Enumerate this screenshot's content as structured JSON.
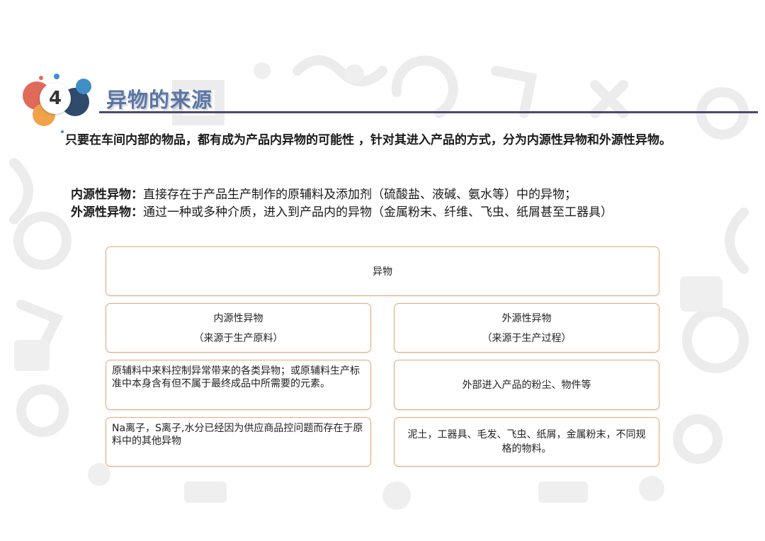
{
  "header": {
    "section_number": "4",
    "section_title": "异物的来源"
  },
  "intro": "只要在车间内部的物品，都有成为产品内异物的可能性 ，针对其进入产品的方式，分为内源性异物和外源性异物。",
  "definitions": [
    {
      "term": "内源性异物：",
      "text": "直接存在于产品生产制作的原辅料及添加剂（硫酸盐、液碱、氨水等）中的异物；"
    },
    {
      "term": "外源性异物：",
      "text": "通过一种或多种介质，进入到产品内的异物（金属粉末、纤维、飞虫、纸屑甚至工器具）"
    }
  ],
  "diagram": {
    "root": "异物",
    "internal": {
      "title": "内源性异物",
      "subtitle": "（来源于生产原料）",
      "description": "原辅料中来料控制异常带来的各类异物；或原辅料生产标准中本身含有但不属于最终成品中所需要的元素。",
      "examples": "Na离子，S离子,水分已经因为供应商品控问题而存在于原料中的其他异物"
    },
    "external": {
      "title": "外源性异物",
      "subtitle": "（来源于生产过程）",
      "description": "外部进入产品的粉尘、物件等",
      "examples": "泥土，工器具、毛发、飞虫、纸屑，金属粉末，不同规格的物料。"
    }
  },
  "colors": {
    "title": "#5a76a8",
    "rule": "#4a4a72",
    "box_border": "#e8a878",
    "badge_red": "#e06a5a",
    "badge_orange": "#f0a24a",
    "badge_blue": "#3f8fc6",
    "badge_navy": "#2f4a6a"
  }
}
